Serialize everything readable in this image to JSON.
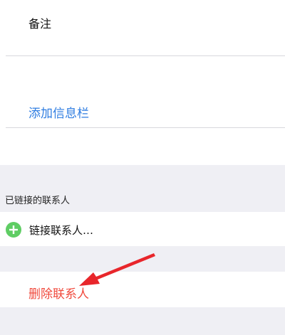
{
  "notes": {
    "label": "备注"
  },
  "add_field": {
    "label": "添加信息栏"
  },
  "linked_contacts": {
    "header": "已链接的联系人",
    "link_label": "链接联系人…"
  },
  "delete": {
    "label": "删除联系人"
  },
  "colors": {
    "accent_blue": "#2f7de1",
    "delete_red": "#f0493c",
    "plus_green": "#5fcd64",
    "group_gray": "#efeff4",
    "annotation_arrow": "#e8262b"
  },
  "icons": {
    "add": "plus-circle-icon",
    "annotation": "annotation-arrow-icon"
  }
}
